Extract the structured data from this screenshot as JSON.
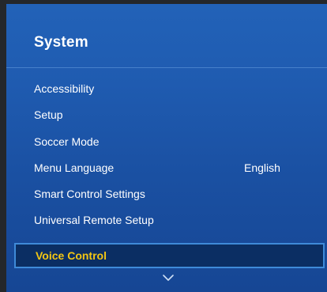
{
  "panel": {
    "title": "System"
  },
  "menu": {
    "items": [
      {
        "label": "Accessibility",
        "value": ""
      },
      {
        "label": "Setup",
        "value": ""
      },
      {
        "label": "Soccer Mode",
        "value": ""
      },
      {
        "label": "Menu Language",
        "value": "English"
      },
      {
        "label": "Smart Control Settings",
        "value": ""
      },
      {
        "label": "Universal Remote Setup",
        "value": ""
      }
    ],
    "selected": {
      "label": "Voice Control"
    }
  },
  "colors": {
    "panel_blue": "#1f5bb0",
    "selected_bg": "#0b2e63",
    "selected_text": "#f3c613",
    "selected_border": "#3f8ad8"
  },
  "icons": {
    "scroll_more": "chevron-down-icon"
  }
}
